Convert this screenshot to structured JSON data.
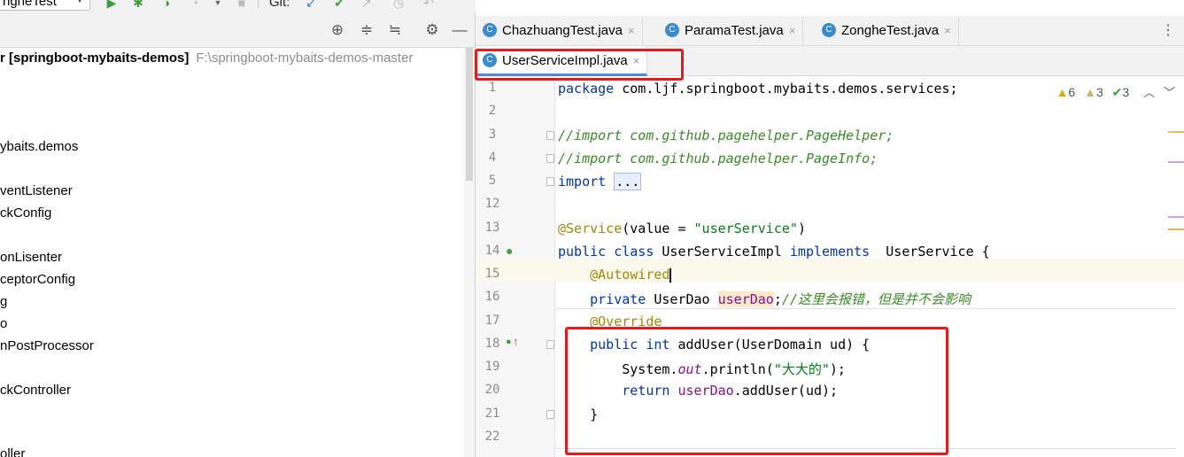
{
  "toolbar": {
    "run_config": "ngheTest",
    "git_label": "Git:"
  },
  "project": {
    "root_name": "r [springboot-mybaits-demos]",
    "root_path": "F:\\springboot-mybaits-demos-master",
    "tree_items": [
      "ybaits.demos",
      "ventListener",
      "ckConfig",
      "onLisenter",
      "ceptorConfig",
      "g",
      "o",
      "nPostProcessor",
      "ckController",
      "oller"
    ]
  },
  "editor": {
    "tabs_row1": [
      {
        "label": "ChazhuangTest.java",
        "close": "×"
      },
      {
        "label": "ParamaTest.java",
        "close": "×"
      },
      {
        "label": "ZongheTest.java",
        "close": "×"
      }
    ],
    "tabs_row2": [
      {
        "label": "UserServiceImpl.java",
        "close": "×",
        "active": true
      }
    ],
    "more_icon": "⋮",
    "inspections": {
      "warnings": "6",
      "weak_warnings": "3",
      "typos": "3"
    },
    "line_numbers": [
      "1",
      "2",
      "3",
      "4",
      "5",
      "12",
      "13",
      "14",
      "15",
      "16",
      "17",
      "18",
      "19",
      "20",
      "21",
      "22"
    ],
    "code": {
      "l1_kw": "package",
      "l1_rest": " com.ljf.springboot.mybaits.demos.services;",
      "l3": "//import com.github.pagehelper.PageHelper;",
      "l4": "//import com.github.pagehelper.PageInfo;",
      "l5_kw": "import",
      "l5_dots": "...",
      "l13_ann": "@Service",
      "l13_a": "(value = ",
      "l13_str": "\"userService\"",
      "l13_b": ")",
      "l14_kw1": "public",
      "l14_kw2": "class",
      "l14_name": " UserServiceImpl ",
      "l14_kw3": "implements",
      "l14_rest": "  UserService {",
      "l15_ann": "@Autowired",
      "l16_kw": "private",
      "l16_type": " UserDao ",
      "l16_fld": "userDao",
      "l16_semi": ";",
      "l16_cm": "//这里会报错，但是并不会影响",
      "l17_ann": "@Override",
      "l18_kw1": "public",
      "l18_kw2": "int",
      "l18_rest": " addUser(UserDomain ud) {",
      "l19_a": "System.",
      "l19_out": "out",
      "l19_b": ".println(",
      "l19_str": "\"大大的\"",
      "l19_c": ");",
      "l20_kw": "return",
      "l20_fld": "userDao",
      "l20_rest": ".addUser(ud);",
      "l21": "}"
    }
  },
  "colors": {
    "highlight_box": "#e51a1a",
    "keyword": "#0033b3",
    "comment": "#3a8a28",
    "string": "#067d17",
    "annotation": "#9e880d",
    "field": "#871094"
  }
}
